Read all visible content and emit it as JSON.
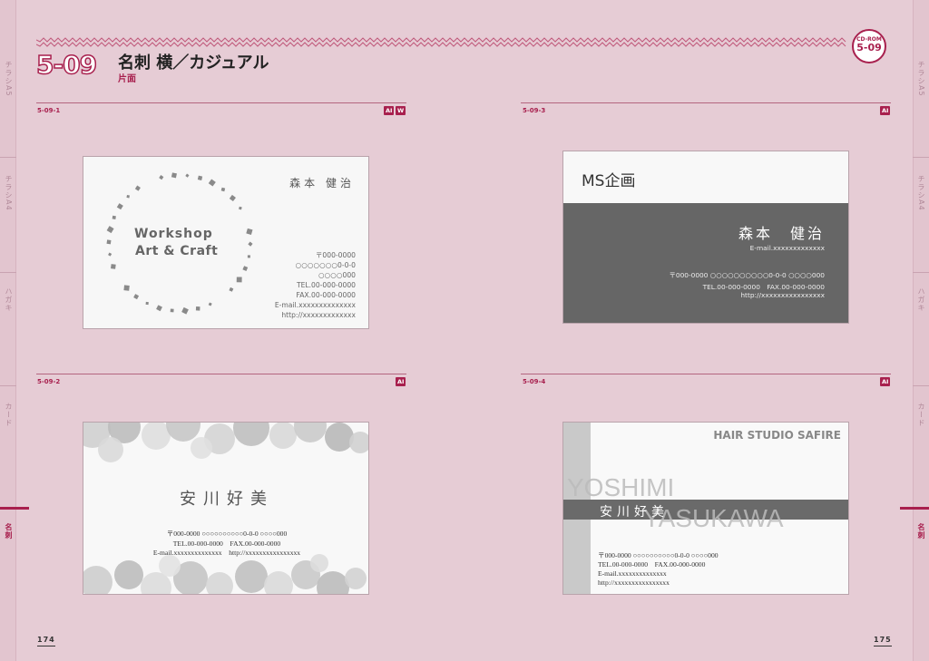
{
  "header": {
    "chapter_number": "5-09",
    "title": "名刺 横／カジュアル",
    "subtitle": "片面",
    "cd_badge": {
      "line1": "CD-ROM",
      "line2": "5-09"
    }
  },
  "side_tabs": [
    "チラシA5",
    "チラシA4",
    "ハガキ",
    "カード",
    "名刺"
  ],
  "active_tab": "名刺",
  "folios": {
    "left": "174",
    "right": "175"
  },
  "colors": {
    "accent": "#a8204e",
    "page_bg": "#e6ccd5",
    "card_dark": "#666666",
    "card_gray": "#c8c8c8"
  },
  "sections": [
    {
      "code": "5-09-1",
      "chips": [
        "AI",
        "W"
      ]
    },
    {
      "code": "5-09-3",
      "chips": [
        "AI"
      ]
    },
    {
      "code": "5-09-2",
      "chips": [
        "AI"
      ]
    },
    {
      "code": "5-09-4",
      "chips": [
        "AI"
      ]
    }
  ],
  "cards": {
    "c1": {
      "name": "森本 健治",
      "logo_line1": "Workshop",
      "logo_line2": "Art & Craft",
      "info": [
        "〒000-0000",
        "○○○○○○○0-0-0",
        "○○○○000",
        "TEL.00-000-0000",
        "FAX.00-000-0000",
        "E-mail.xxxxxxxxxxxxxx",
        "http://xxxxxxxxxxxxx"
      ]
    },
    "c3": {
      "company": "MS企画",
      "name": "森本　健治",
      "email": "E-mail.xxxxxxxxxxxxx",
      "address": "〒000-0000 ○○○○○○○○○○0-0-0 ○○○○000",
      "telfax": "TEL.00-000-0000　FAX.00-000-0000",
      "http": "http://xxxxxxxxxxxxxxxx"
    },
    "c2": {
      "name": "安川好美",
      "address": "〒000-0000 ○○○○○○○○○○0-0-0 ○○○○000",
      "telfax": "TEL.00-000-0000　FAX.00-000-0000",
      "email_http": "E-mail.xxxxxxxxxxxxxx　http://xxxxxxxxxxxxxxxx"
    },
    "c4": {
      "studio": "HAIR STUDIO SAFIRE",
      "roman_first": "YOSHIMI",
      "roman_last": "YASUKAWA",
      "name": "安川好美",
      "address": "〒000-0000 ○○○○○○○○○○0-0-0 ○○○○000",
      "telfax": "TEL.00-000-0000　FAX.00-000-0000",
      "email": "E-mail.xxxxxxxxxxxxxx",
      "http": "http://xxxxxxxxxxxxxxxx"
    }
  }
}
